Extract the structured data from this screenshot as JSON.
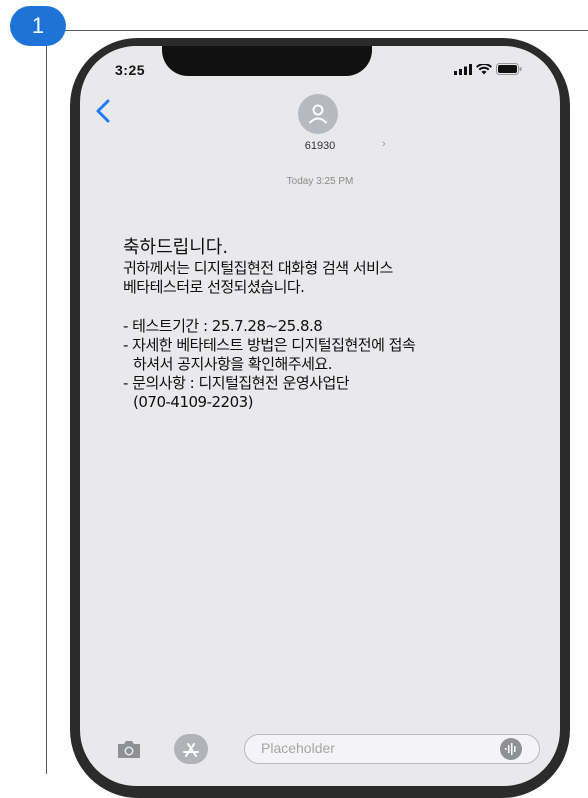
{
  "step_number": "1",
  "status_bar": {
    "time": "3:25"
  },
  "header": {
    "sender_id": "61930"
  },
  "conversation": {
    "timestamp": "Today 3:25 PM",
    "message": {
      "title": "축하드립니다.",
      "lines": [
        "귀하께서는 디지털집현전 대화형 검색 서비스",
        "베타테스터로 선정되셨습니다.",
        "- 테스트기간 : 25.7.28~25.8.8",
        "- 자세한 베타테스트 방법은 디지털집현전에 접속",
        "하셔서 공지사항을 확인해주세요.",
        "- 문의사항 : 디지털집현전 운영사업단",
        "(070-4109-2203)"
      ]
    }
  },
  "compose": {
    "placeholder": "Placeholder"
  },
  "colors": {
    "badge": "#1e73d6",
    "link_blue": "#1a7cf5",
    "frame": "#2b2b2b",
    "screen_bg": "#e9e9ec"
  },
  "icons": [
    "back-icon",
    "contact-avatar-icon",
    "camera-icon",
    "app-store-icon",
    "audio-message-icon",
    "signal-icon",
    "wifi-icon",
    "battery-icon"
  ]
}
